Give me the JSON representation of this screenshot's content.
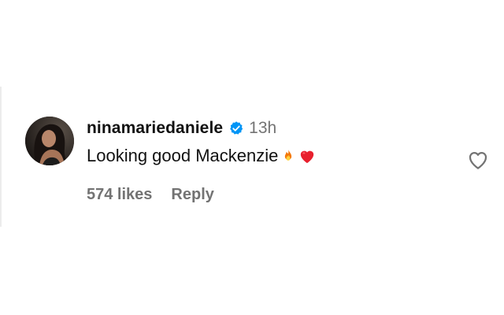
{
  "comment": {
    "username": "ninamariedaniele",
    "verified_icon": "verified-badge-icon",
    "time": "13h",
    "text": "Looking good Mackenzie",
    "emojis": [
      "fire-emoji",
      "red-heart-emoji"
    ],
    "likes": "574 likes",
    "reply_label": "Reply",
    "like_icon": "heart-outline-icon"
  },
  "colors": {
    "text_primary": "#111111",
    "text_secondary": "#737373",
    "verified_blue": "#0095f6"
  }
}
